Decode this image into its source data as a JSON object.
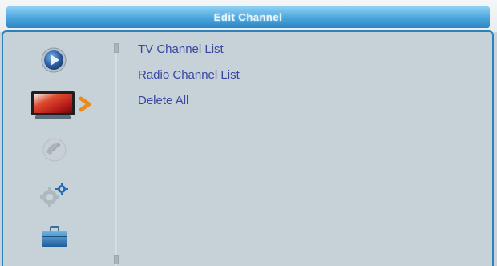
{
  "header": {
    "title": "Edit Channel"
  },
  "sidebar": {
    "items": [
      {
        "name": "media-play",
        "icon": "play-circle-icon"
      },
      {
        "name": "tv-channel",
        "icon": "tv-icon",
        "selected": true
      },
      {
        "name": "installation",
        "icon": "satellite-dish-icon"
      },
      {
        "name": "system",
        "icon": "gear-icon"
      },
      {
        "name": "tools",
        "icon": "toolbox-icon"
      }
    ],
    "selected_indicator": "chevron-right-icon"
  },
  "menu": {
    "items": [
      {
        "label": "TV Channel List"
      },
      {
        "label": "Radio Channel List"
      },
      {
        "label": "Delete All"
      }
    ]
  },
  "colors": {
    "title_bar": "#4aa4dc",
    "frame_border": "#2f82b9",
    "background": "#c7d1d8",
    "menu_text": "#3848a0",
    "selection_arrow": "#ee8a1a"
  }
}
